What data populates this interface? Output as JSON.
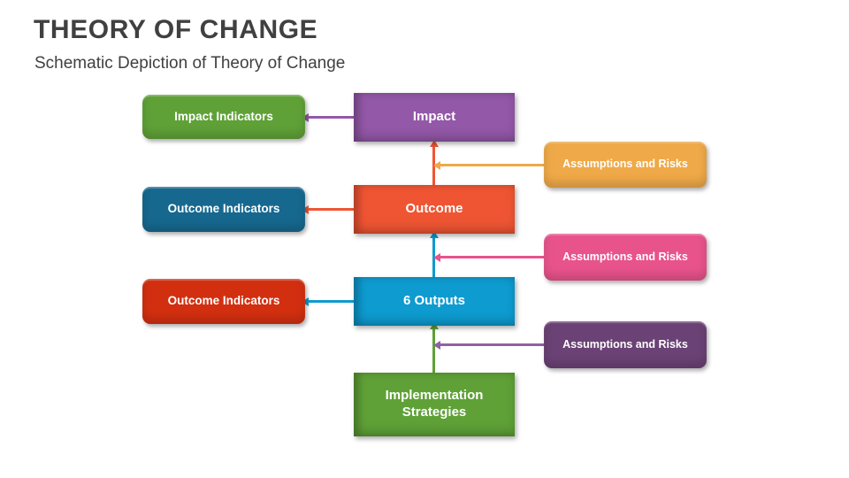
{
  "slide": {
    "title": "THEORY OF CHANGE",
    "subtitle": "Schematic Depiction of Theory of Change",
    "background": "#ffffff",
    "title_color": "#404040"
  },
  "diagram": {
    "type": "flowchart",
    "indicator_nodes": [
      {
        "id": "impact-indicators",
        "label": "Impact Indicators",
        "color": "#5fa137",
        "shape": "rounded"
      },
      {
        "id": "outcome-indicators-1",
        "label": "Outcome Indicators",
        "color": "#16688f",
        "shape": "rounded"
      },
      {
        "id": "outcome-indicators-2",
        "label": "Outcome Indicators",
        "color": "#d22f10",
        "shape": "rounded"
      }
    ],
    "chain_nodes": [
      {
        "id": "impact",
        "label": "Impact",
        "color": "#9358a8",
        "shape": "squared"
      },
      {
        "id": "outcome",
        "label": "Outcome",
        "color": "#ef5533",
        "shape": "squared"
      },
      {
        "id": "outputs",
        "label": "6 Outputs",
        "color": "#0e9bd0",
        "shape": "squared"
      },
      {
        "id": "implementation-strategies",
        "label": "Implementation\nStrategies",
        "color": "#5fa137",
        "shape": "squared"
      }
    ],
    "risk_nodes": [
      {
        "id": "assumptions-risks-1",
        "label": "Assumptions and Risks",
        "color": "#efa948",
        "shape": "rounded"
      },
      {
        "id": "assumptions-risks-2",
        "label": "Assumptions and Risks",
        "color": "#e8538c",
        "shape": "rounded"
      },
      {
        "id": "assumptions-risks-3",
        "label": "Assumptions and Risks",
        "color": "#6b4275",
        "shape": "rounded"
      }
    ],
    "connectors": [
      {
        "id": "impact-to-impact-indicators",
        "from": "impact",
        "to": "impact-indicators",
        "color": "#9358a8",
        "direction": "left"
      },
      {
        "id": "outcome-to-outcome-indicators",
        "from": "outcome",
        "to": "outcome-indicators-1",
        "color": "#ef5533",
        "direction": "left"
      },
      {
        "id": "outputs-to-outcome-indicators",
        "from": "outputs",
        "to": "outcome-indicators-2",
        "color": "#0e9bd0",
        "direction": "left"
      },
      {
        "id": "outcome-to-impact",
        "from": "outcome",
        "to": "impact",
        "color": "#ef5533",
        "direction": "up"
      },
      {
        "id": "outputs-to-outcome",
        "from": "outputs",
        "to": "outcome",
        "color": "#0e9bd0",
        "direction": "up"
      },
      {
        "id": "strategies-to-outputs",
        "from": "implementation-strategies",
        "to": "outputs",
        "color": "#5fa137",
        "direction": "up"
      },
      {
        "id": "risk1-to-outcome-impact-link",
        "from": "assumptions-risks-1",
        "to": "outcome-to-impact",
        "color": "#efa948",
        "direction": "left"
      },
      {
        "id": "risk2-to-outputs-outcome-link",
        "from": "assumptions-risks-2",
        "to": "outputs-to-outcome",
        "color": "#e8538c",
        "direction": "left"
      },
      {
        "id": "risk3-to-strategies-outputs-link",
        "from": "assumptions-risks-3",
        "to": "strategies-to-outputs",
        "color": "#6b4275",
        "direction": "left"
      }
    ]
  }
}
